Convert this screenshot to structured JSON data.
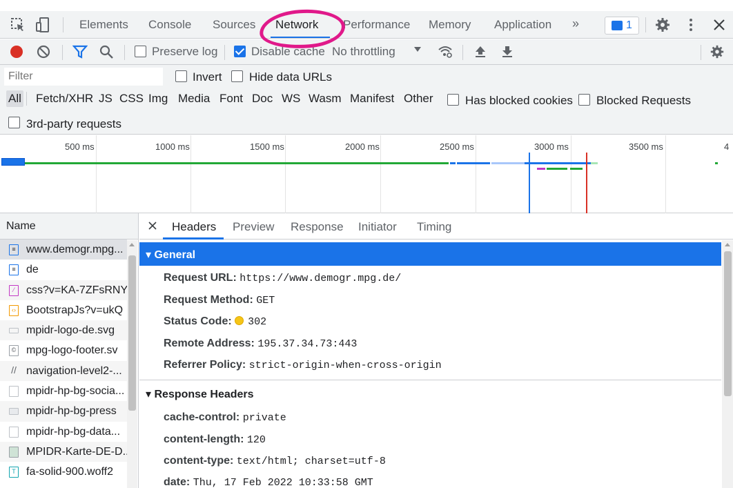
{
  "tabs": {
    "elements": "Elements",
    "console": "Console",
    "sources": "Sources",
    "network": "Network",
    "performance": "Performance",
    "memory": "Memory",
    "application": "Application",
    "more": "»",
    "messages_count": "1"
  },
  "toolbar": {
    "preserve_log": "Preserve log",
    "disable_cache": "Disable cache",
    "throttling": "No throttling"
  },
  "filter": {
    "placeholder": "Filter",
    "invert": "Invert",
    "hide_data_urls": "Hide data URLs",
    "types": [
      "All",
      "Fetch/XHR",
      "JS",
      "CSS",
      "Img",
      "Media",
      "Font",
      "Doc",
      "WS",
      "Wasm",
      "Manifest",
      "Other"
    ],
    "has_blocked_cookies": "Has blocked cookies",
    "blocked_requests": "Blocked Requests",
    "third_party": "3rd-party requests"
  },
  "overview": {
    "ticks": [
      "500 ms",
      "1000 ms",
      "1500 ms",
      "2000 ms",
      "2500 ms",
      "3000 ms",
      "3500 ms",
      "4"
    ]
  },
  "requests": {
    "header": "Name",
    "items": [
      "www.demogr.mpg...",
      "de",
      "css?v=KA-7ZFsRNY",
      "BootstrapJs?v=ukQ",
      "mpidr-logo-de.svg",
      "mpg-logo-footer.sv",
      "navigation-level2-...",
      "mpidr-hp-bg-socia...",
      "mpidr-hp-bg-press",
      "mpidr-hp-bg-data...",
      "MPIDR-Karte-DE-D...",
      "fa-solid-900.woff2"
    ]
  },
  "details": {
    "tabs": [
      "Headers",
      "Preview",
      "Response",
      "Initiator",
      "Timing"
    ],
    "general_title": "General",
    "general": {
      "request_url_k": "Request URL:",
      "request_url_v": "https://www.demogr.mpg.de/",
      "request_method_k": "Request Method:",
      "request_method_v": "GET",
      "status_code_k": "Status Code:",
      "status_code_v": "302",
      "remote_address_k": "Remote Address:",
      "remote_address_v": "195.37.34.73:443",
      "referrer_policy_k": "Referrer Policy:",
      "referrer_policy_v": "strict-origin-when-cross-origin"
    },
    "response_title": "Response Headers",
    "response": {
      "cache_control_k": "cache-control:",
      "cache_control_v": "private",
      "content_length_k": "content-length:",
      "content_length_v": "120",
      "content_type_k": "content-type:",
      "content_type_v": "text/html; charset=utf-8",
      "date_k": "date:",
      "date_v": "Thu, 17 Feb 2022 10:33:58 GMT"
    }
  },
  "colors": {
    "accent": "#1a73e8",
    "record": "#d93025",
    "highlight": "#e0198a"
  }
}
